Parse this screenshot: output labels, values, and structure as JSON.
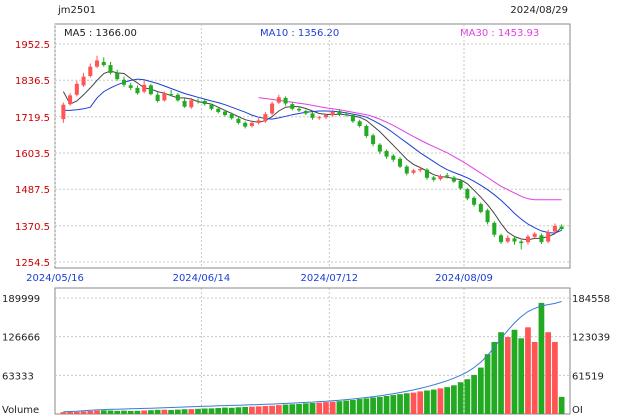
{
  "header": {
    "symbol": "jm2501",
    "date": "2024/08/29",
    "ma5_label": "MA5 : 1366.00",
    "ma10_label": "MA10 : 1356.20",
    "ma30_label": "MA30 : 1453.93"
  },
  "colors": {
    "up": "#ff5555",
    "down": "#22aa22",
    "ma5": "#444444",
    "ma10": "#1a3fd6",
    "ma30": "#e040e0",
    "oi": "#3a7bd5",
    "price_axis": "#cc0000",
    "grid": "#c8c8c8"
  },
  "chart_data": [
    {
      "type": "candlestick",
      "title": "jm2501",
      "yticks": [
        "1952.5",
        "1836.5",
        "1719.5",
        "1603.5",
        "1487.5",
        "1370.5",
        "1254.5"
      ],
      "ylim": [
        1254.5,
        1952.5
      ],
      "xtick_labels": [
        "2024/05/16",
        "2024/06/14",
        "2024/07/12",
        "2024/08/09"
      ],
      "xtick_index": [
        0,
        21,
        40,
        60
      ],
      "x": [
        "2024/05/16",
        "2024/05/17",
        "2024/05/20",
        "2024/05/21",
        "2024/05/22",
        "2024/05/23",
        "2024/05/24",
        "2024/05/27",
        "2024/05/28",
        "2024/05/29",
        "2024/05/30",
        "2024/05/31",
        "2024/06/03",
        "2024/06/04",
        "2024/06/05",
        "2024/06/06",
        "2024/06/07",
        "2024/06/11",
        "2024/06/12",
        "2024/06/13",
        "2024/06/14",
        "2024/06/17",
        "2024/06/18",
        "2024/06/19",
        "2024/06/20",
        "2024/06/21",
        "2024/06/24",
        "2024/06/25",
        "2024/06/26",
        "2024/06/27",
        "2024/06/28",
        "2024/07/01",
        "2024/07/02",
        "2024/07/03",
        "2024/07/04",
        "2024/07/05",
        "2024/07/08",
        "2024/07/09",
        "2024/07/10",
        "2024/07/11",
        "2024/07/12",
        "2024/07/15",
        "2024/07/16",
        "2024/07/17",
        "2024/07/18",
        "2024/07/19",
        "2024/07/22",
        "2024/07/23",
        "2024/07/24",
        "2024/07/25",
        "2024/07/26",
        "2024/07/29",
        "2024/07/30",
        "2024/07/31",
        "2024/08/01",
        "2024/08/02",
        "2024/08/05",
        "2024/08/06",
        "2024/08/07",
        "2024/08/08",
        "2024/08/09",
        "2024/08/12",
        "2024/08/13",
        "2024/08/14",
        "2024/08/15",
        "2024/08/16",
        "2024/08/19",
        "2024/08/20",
        "2024/08/21",
        "2024/08/22",
        "2024/08/23",
        "2024/08/26",
        "2024/08/27",
        "2024/08/28",
        "2024/08/29"
      ],
      "open": [
        1712,
        1760,
        1790,
        1820,
        1850,
        1880,
        1895,
        1885,
        1860,
        1838,
        1820,
        1812,
        1800,
        1820,
        1790,
        1772,
        1792,
        1790,
        1770,
        1750,
        1770,
        1770,
        1758,
        1745,
        1736,
        1728,
        1713,
        1700,
        1690,
        1700,
        1705,
        1730,
        1765,
        1780,
        1760,
        1745,
        1738,
        1730,
        1715,
        1718,
        1725,
        1738,
        1728,
        1725,
        1705,
        1690,
        1660,
        1630,
        1610,
        1595,
        1585,
        1560,
        1540,
        1548,
        1550,
        1525,
        1520,
        1532,
        1525,
        1515,
        1488,
        1460,
        1440,
        1420,
        1380,
        1340,
        1320,
        1330,
        1320,
        1318,
        1335,
        1340,
        1320,
        1352,
        1368
      ],
      "close": [
        1758,
        1788,
        1825,
        1848,
        1880,
        1900,
        1885,
        1860,
        1840,
        1822,
        1812,
        1795,
        1822,
        1792,
        1770,
        1795,
        1790,
        1772,
        1752,
        1772,
        1768,
        1760,
        1745,
        1735,
        1725,
        1715,
        1700,
        1688,
        1700,
        1708,
        1728,
        1762,
        1782,
        1762,
        1745,
        1740,
        1730,
        1716,
        1718,
        1725,
        1735,
        1728,
        1725,
        1705,
        1690,
        1658,
        1632,
        1608,
        1592,
        1582,
        1560,
        1538,
        1548,
        1552,
        1524,
        1518,
        1530,
        1528,
        1512,
        1490,
        1458,
        1438,
        1415,
        1382,
        1342,
        1318,
        1332,
        1320,
        1315,
        1336,
        1345,
        1318,
        1350,
        1370,
        1360
      ],
      "high": [
        1765,
        1795,
        1835,
        1860,
        1890,
        1915,
        1910,
        1895,
        1870,
        1848,
        1828,
        1820,
        1835,
        1825,
        1798,
        1800,
        1805,
        1795,
        1778,
        1780,
        1778,
        1775,
        1762,
        1750,
        1742,
        1733,
        1718,
        1705,
        1705,
        1715,
        1735,
        1768,
        1790,
        1785,
        1765,
        1750,
        1742,
        1735,
        1722,
        1730,
        1742,
        1744,
        1735,
        1730,
        1710,
        1695,
        1665,
        1635,
        1615,
        1600,
        1590,
        1565,
        1552,
        1560,
        1555,
        1530,
        1535,
        1540,
        1530,
        1518,
        1492,
        1465,
        1445,
        1425,
        1385,
        1345,
        1340,
        1338,
        1325,
        1342,
        1350,
        1345,
        1358,
        1378,
        1375
      ],
      "low": [
        1700,
        1755,
        1785,
        1815,
        1845,
        1875,
        1880,
        1855,
        1835,
        1815,
        1805,
        1790,
        1795,
        1788,
        1765,
        1768,
        1785,
        1768,
        1748,
        1745,
        1762,
        1755,
        1740,
        1730,
        1720,
        1710,
        1695,
        1682,
        1685,
        1695,
        1700,
        1725,
        1760,
        1755,
        1740,
        1735,
        1725,
        1710,
        1710,
        1712,
        1720,
        1722,
        1720,
        1700,
        1685,
        1652,
        1625,
        1600,
        1585,
        1575,
        1555,
        1532,
        1535,
        1542,
        1518,
        1512,
        1515,
        1522,
        1508,
        1485,
        1452,
        1432,
        1410,
        1375,
        1335,
        1312,
        1315,
        1310,
        1295,
        1310,
        1330,
        1312,
        1315,
        1345,
        1355
      ],
      "ma5": [
        1800,
        1760,
        1770,
        1790,
        1812,
        1836,
        1858,
        1866,
        1860,
        1858,
        1842,
        1828,
        1812,
        1808,
        1800,
        1795,
        1787,
        1780,
        1780,
        1776,
        1768,
        1764,
        1760,
        1750,
        1740,
        1730,
        1720,
        1710,
        1705,
        1702,
        1707,
        1720,
        1738,
        1750,
        1752,
        1752,
        1746,
        1738,
        1730,
        1727,
        1726,
        1728,
        1726,
        1722,
        1718,
        1708,
        1690,
        1672,
        1650,
        1628,
        1606,
        1583,
        1567,
        1557,
        1546,
        1534,
        1528,
        1526,
        1522,
        1518,
        1505,
        1484,
        1462,
        1438,
        1410,
        1378,
        1350,
        1336,
        1328,
        1326,
        1330,
        1330,
        1336,
        1345,
        1366
      ],
      "ma10": [
        1740,
        1740,
        1742,
        1745,
        1750,
        1780,
        1800,
        1812,
        1822,
        1830,
        1836,
        1840,
        1838,
        1832,
        1826,
        1818,
        1810,
        1802,
        1794,
        1788,
        1782,
        1776,
        1770,
        1765,
        1758,
        1750,
        1742,
        1734,
        1725,
        1718,
        1714,
        1712,
        1716,
        1721,
        1726,
        1730,
        1734,
        1736,
        1738,
        1738,
        1737,
        1735,
        1732,
        1728,
        1724,
        1718,
        1708,
        1696,
        1683,
        1668,
        1652,
        1636,
        1620,
        1604,
        1590,
        1576,
        1562,
        1550,
        1541,
        1533,
        1524,
        1513,
        1500,
        1486,
        1470,
        1452,
        1432,
        1410,
        1392,
        1376,
        1364,
        1354,
        1349,
        1347,
        1356
      ],
      "ma30": [
        null,
        null,
        null,
        null,
        null,
        null,
        null,
        null,
        null,
        null,
        null,
        null,
        null,
        null,
        null,
        null,
        null,
        null,
        null,
        null,
        null,
        null,
        null,
        null,
        null,
        null,
        null,
        null,
        null,
        1781,
        1778,
        1775,
        1772,
        1769,
        1766,
        1763,
        1760,
        1756,
        1752,
        1748,
        1745,
        1742,
        1738,
        1734,
        1730,
        1726,
        1720,
        1712,
        1702,
        1692,
        1680,
        1668,
        1656,
        1645,
        1634,
        1624,
        1614,
        1604,
        1592,
        1580,
        1567,
        1553,
        1539,
        1525,
        1511,
        1497,
        1486,
        1475,
        1465,
        1457,
        1453.93,
        1453.93,
        1453.93,
        1453.93,
        1453.93
      ]
    },
    {
      "type": "bar",
      "title": "Volume / OI",
      "ylabel_left": "Volume",
      "ylabel_right": "OI",
      "yticks_left": [
        "189999",
        "126666",
        "63333"
      ],
      "yticks_right": [
        "184558",
        "123039",
        "61519"
      ],
      "ylim_left": [
        0,
        189999
      ],
      "ylim_right": [
        0,
        184558
      ],
      "volume": [
        3000,
        3200,
        3500,
        4200,
        5000,
        5500,
        6000,
        5800,
        5200,
        5500,
        5000,
        5200,
        5800,
        6200,
        6800,
        7000,
        6500,
        7200,
        7800,
        8000,
        8500,
        9000,
        9200,
        9800,
        10500,
        10200,
        11000,
        11500,
        12000,
        12500,
        13000,
        13500,
        14500,
        15500,
        16000,
        16500,
        17500,
        18000,
        18500,
        19500,
        20000,
        21000,
        22000,
        23000,
        24500,
        25500,
        27000,
        28000,
        29500,
        31000,
        32500,
        34000,
        35000,
        37000,
        38500,
        40000,
        42000,
        44000,
        47000,
        52000,
        57000,
        64000,
        76000,
        98000,
        118000,
        134000,
        126000,
        138000,
        124000,
        142000,
        118000,
        182000,
        134000,
        118000,
        28000
      ],
      "oi": [
        3500,
        4000,
        4500,
        5200,
        6000,
        6500,
        7000,
        7400,
        7700,
        8000,
        8300,
        8600,
        8900,
        9200,
        9600,
        10000,
        10400,
        10800,
        11200,
        11600,
        12000,
        12300,
        12600,
        13000,
        13300,
        13700,
        14000,
        14300,
        14600,
        15000,
        15400,
        15800,
        16300,
        16800,
        17300,
        17800,
        18400,
        19000,
        19700,
        20400,
        21200,
        22000,
        22900,
        23900,
        25000,
        26200,
        27500,
        29000,
        30600,
        32300,
        34200,
        36200,
        38400,
        40800,
        43400,
        46300,
        49500,
        53000,
        57000,
        61500,
        67000,
        74000,
        82500,
        93000,
        106000,
        120000,
        133000,
        145000,
        155000,
        163000,
        168000,
        172000,
        174000,
        176000,
        179000
      ]
    }
  ]
}
